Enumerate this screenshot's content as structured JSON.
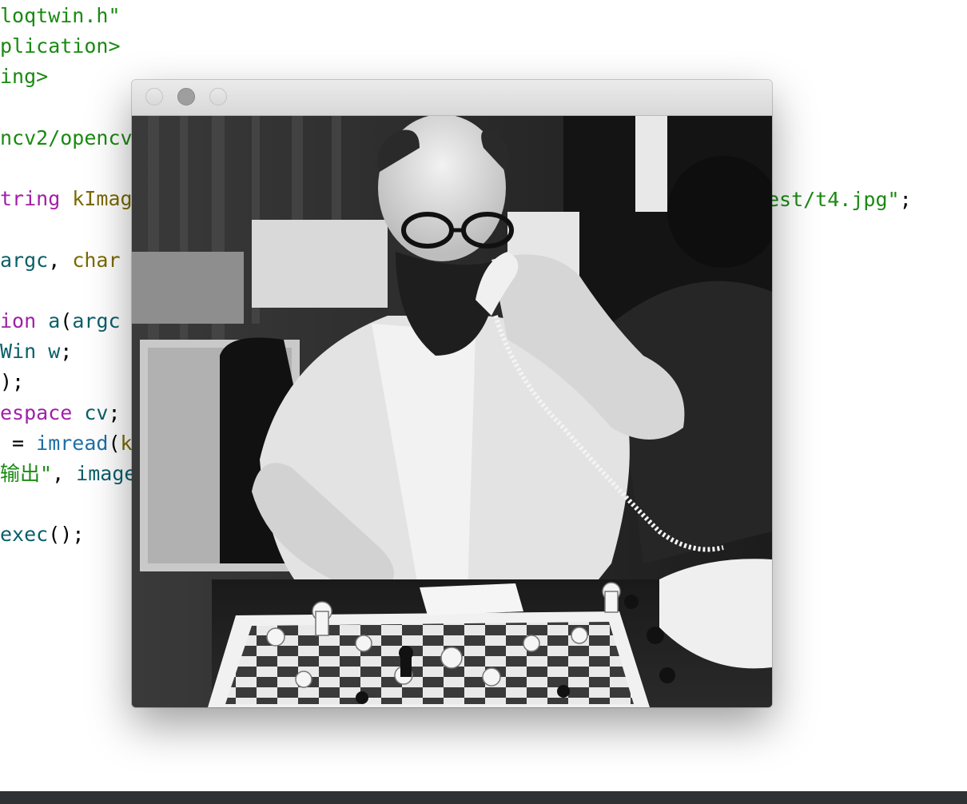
{
  "editor": {
    "lines": [
      {
        "row": 0,
        "tokens": [
          {
            "c": "str",
            "t": "loqtwin.h\""
          }
        ]
      },
      {
        "row": 1,
        "tokens": [
          {
            "c": "str",
            "t": "plication>"
          }
        ]
      },
      {
        "row": 2,
        "tokens": [
          {
            "c": "str",
            "t": "ing>"
          }
        ]
      },
      {
        "row": 4,
        "tokens": [
          {
            "c": "str",
            "t": "ncv2/opencv"
          }
        ]
      },
      {
        "row": 6,
        "tokens": [
          {
            "c": "kw",
            "t": "tring"
          },
          {
            "c": "plain",
            "t": " "
          },
          {
            "c": "type",
            "t": "kImag"
          }
        ]
      },
      {
        "row": 8,
        "tokens": [
          {
            "c": "var",
            "t": "argc"
          },
          {
            "c": "plain",
            "t": ", "
          },
          {
            "c": "type",
            "t": "char"
          }
        ]
      },
      {
        "row": 10,
        "tokens": [
          {
            "c": "kw",
            "t": "ion"
          },
          {
            "c": "plain",
            "t": " "
          },
          {
            "c": "var",
            "t": "a"
          },
          {
            "c": "plain",
            "t": "("
          },
          {
            "c": "var",
            "t": "argc"
          }
        ]
      },
      {
        "row": 11,
        "tokens": [
          {
            "c": "var",
            "t": "Win w"
          },
          {
            "c": "plain",
            "t": ";"
          }
        ]
      },
      {
        "row": 12,
        "tokens": [
          {
            "c": "plain",
            "t": ");"
          }
        ]
      },
      {
        "row": 13,
        "tokens": [
          {
            "c": "kw",
            "t": "espace"
          },
          {
            "c": "plain",
            "t": " "
          },
          {
            "c": "var",
            "t": "cv"
          },
          {
            "c": "plain",
            "t": ";"
          }
        ]
      },
      {
        "row": 14,
        "tokens": [
          {
            "c": "plain",
            "t": " = "
          },
          {
            "c": "fn",
            "t": "imread"
          },
          {
            "c": "plain",
            "t": "("
          },
          {
            "c": "type",
            "t": "k"
          }
        ]
      },
      {
        "row": 15,
        "tokens": [
          {
            "c": "str",
            "t": "输出\""
          },
          {
            "c": "plain",
            "t": ", "
          },
          {
            "c": "var",
            "t": "image"
          }
        ]
      },
      {
        "row": 17,
        "tokens": [
          {
            "c": "var",
            "t": "exec"
          },
          {
            "c": "plain",
            "t": "();"
          }
        ]
      }
    ],
    "tail": [
      {
        "c": "str",
        "t": "est/t4.jpg\""
      },
      {
        "c": "plain",
        "t": ";"
      }
    ]
  },
  "image_window": {
    "buttons": [
      "close-button",
      "minimize-button",
      "zoom-button"
    ],
    "image_description": "black-and-white photo of a bearded man on a telephone at a chess board",
    "colors": {
      "active_button": "#9e9e9e",
      "statusbar": "#2f3133"
    }
  }
}
